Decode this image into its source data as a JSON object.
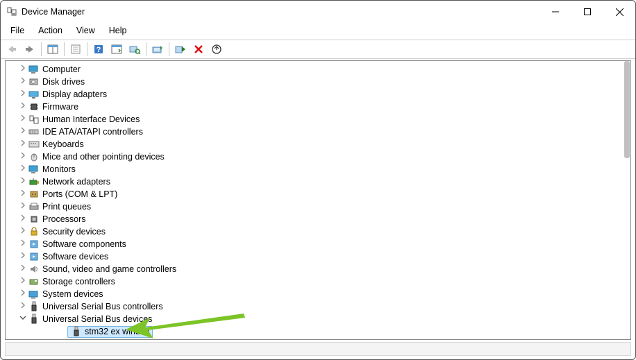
{
  "window": {
    "title": "Device Manager"
  },
  "menu": {
    "file": "File",
    "action": "Action",
    "view": "View",
    "help": "Help"
  },
  "tree": {
    "lvl1_indent": 16,
    "items": [
      {
        "label": "Computer",
        "expanded": false,
        "icon": "monitor"
      },
      {
        "label": "Disk drives",
        "expanded": false,
        "icon": "disk"
      },
      {
        "label": "Display adapters",
        "expanded": false,
        "icon": "display"
      },
      {
        "label": "Firmware",
        "expanded": false,
        "icon": "chip"
      },
      {
        "label": "Human Interface Devices",
        "expanded": false,
        "icon": "hid"
      },
      {
        "label": "IDE ATA/ATAPI controllers",
        "expanded": false,
        "icon": "ide"
      },
      {
        "label": "Keyboards",
        "expanded": false,
        "icon": "keyboard"
      },
      {
        "label": "Mice and other pointing devices",
        "expanded": false,
        "icon": "mouse"
      },
      {
        "label": "Monitors",
        "expanded": false,
        "icon": "monitor"
      },
      {
        "label": "Network adapters",
        "expanded": false,
        "icon": "net"
      },
      {
        "label": "Ports (COM & LPT)",
        "expanded": false,
        "icon": "port"
      },
      {
        "label": "Print queues",
        "expanded": false,
        "icon": "printer"
      },
      {
        "label": "Processors",
        "expanded": false,
        "icon": "cpu"
      },
      {
        "label": "Security devices",
        "expanded": false,
        "icon": "lock"
      },
      {
        "label": "Software components",
        "expanded": false,
        "icon": "sw"
      },
      {
        "label": "Software devices",
        "expanded": false,
        "icon": "sw"
      },
      {
        "label": "Sound, video and game controllers",
        "expanded": false,
        "icon": "sound"
      },
      {
        "label": "Storage controllers",
        "expanded": false,
        "icon": "storage"
      },
      {
        "label": "System devices",
        "expanded": false,
        "icon": "system"
      },
      {
        "label": "Universal Serial Bus controllers",
        "expanded": false,
        "icon": "usb"
      },
      {
        "label": "Universal Serial Bus devices",
        "expanded": true,
        "icon": "usb",
        "children": [
          {
            "label": "stm32 ex winusb",
            "icon": "usb",
            "selected": true
          }
        ]
      }
    ]
  },
  "annotation": {
    "color": "#7cc427"
  }
}
